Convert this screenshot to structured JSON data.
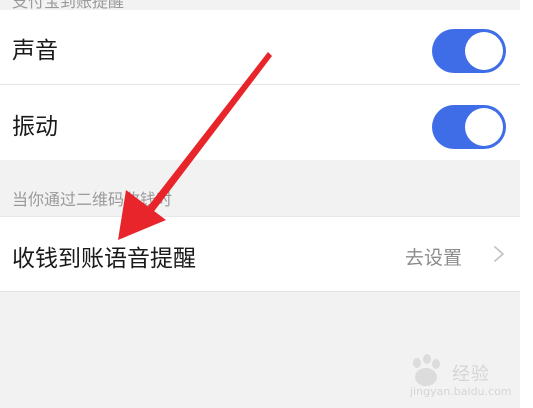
{
  "top_section": {
    "caption": "支付宝到账提醒"
  },
  "settings": [
    {
      "label": "声音",
      "enabled": true
    },
    {
      "label": "振动",
      "enabled": true
    }
  ],
  "qr_section": {
    "caption": "当你通过二维码收钱时",
    "reminder_label": "收钱到账语音提醒",
    "reminder_value": "去设置"
  },
  "watermark": {
    "text": "经验",
    "sub": "jingyan.baidu.com"
  },
  "colors": {
    "toggle_on": "#3f6de8",
    "annotation_arrow": "#e8252b"
  }
}
